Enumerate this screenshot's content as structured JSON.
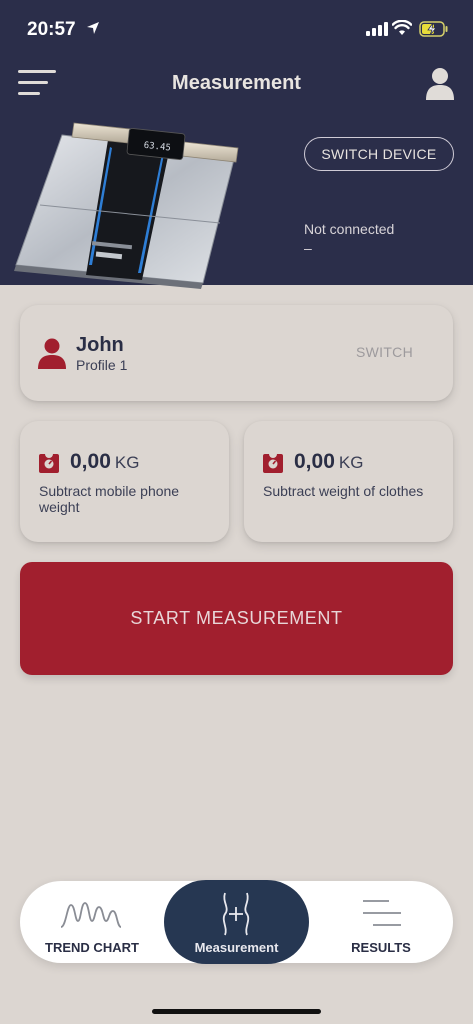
{
  "status_bar": {
    "time": "20:57"
  },
  "header": {
    "title": "Measurement",
    "switch_device_label": "SWITCH DEVICE",
    "connection_status": "Not connected",
    "connection_value": "–",
    "device_display": "63.45"
  },
  "profile": {
    "name": "John",
    "subtitle": "Profile 1",
    "switch_label": "SWITCH"
  },
  "weights": [
    {
      "value": "0,00",
      "unit": "KG",
      "description": "Subtract mobile phone weight"
    },
    {
      "value": "0,00",
      "unit": "KG",
      "description": "Subtract weight of clothes"
    }
  ],
  "start_button": {
    "label": "START MEASUREMENT"
  },
  "tabbar": {
    "tabs": [
      {
        "label": "TREND CHART"
      },
      {
        "label": "Measurement"
      },
      {
        "label": "RESULTS"
      }
    ]
  },
  "colors": {
    "header_bg": "#2b2e4a",
    "accent_red": "#a11f2e",
    "background": "#dcd6d1",
    "active_tab": "#263752"
  }
}
